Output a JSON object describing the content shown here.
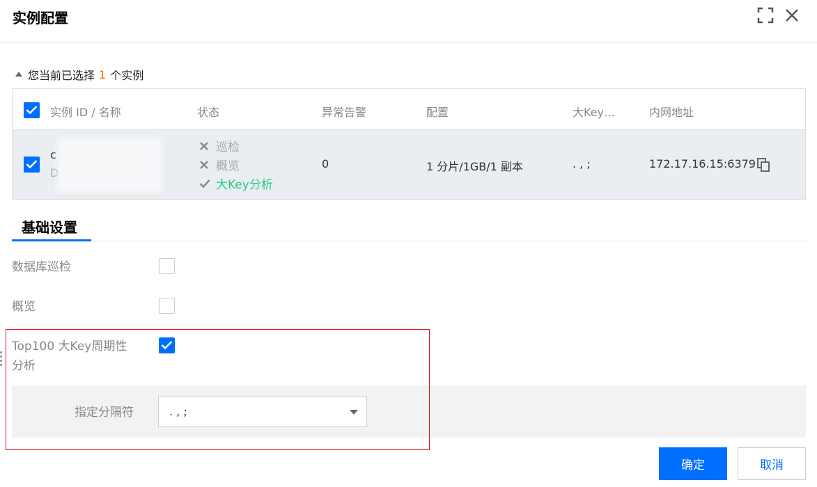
{
  "dialog": {
    "title": "实例配置"
  },
  "summary": {
    "prefix": "您当前已选择",
    "count": "1",
    "suffix": "个实例"
  },
  "table": {
    "headers": [
      "实例 ID / 名称",
      "状态",
      "异常告警",
      "配置",
      "大Key…",
      "内网地址"
    ],
    "row": {
      "id_initial": "c",
      "name_initial": "D",
      "statuses": [
        {
          "label": "巡检",
          "enabled": false
        },
        {
          "label": "概览",
          "enabled": false
        },
        {
          "label": "大Key分析",
          "enabled": true
        }
      ],
      "alerts": "0",
      "config": "1 分片/1GB/1 副本",
      "bigkey": ". , ;",
      "address": "172.17.16.15:6379"
    }
  },
  "tabs": {
    "active": "基础设置"
  },
  "form": {
    "db_inspection_label": "数据库巡检",
    "overview_label": "概览",
    "bigkey_label_line1": "Top100 大Key周期性",
    "bigkey_label_line2": "分析",
    "separator_label": "指定分隔符",
    "separator_value": ". , ;"
  },
  "footer": {
    "ok_label": "确定",
    "cancel_label": "取消"
  },
  "colors": {
    "primary": "#006eff",
    "accent_count": "#ff7200",
    "success": "#29cc85",
    "highlight_border": "#e1131f"
  }
}
